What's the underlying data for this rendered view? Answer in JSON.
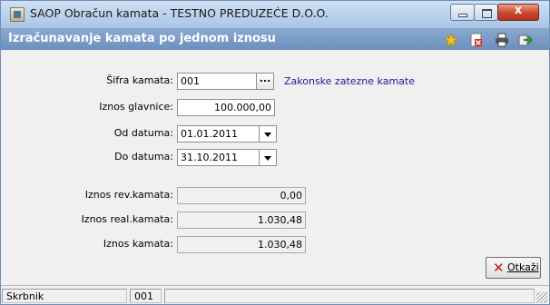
{
  "window": {
    "title": "SAOP Obračun kamata - TESTNO PREDUZEĆE D.O.O.",
    "close_glyph": "x"
  },
  "header": {
    "title": "Izračunavanje kamata po jednom iznosu",
    "toolbar_icons": [
      "star-icon",
      "close-document-icon",
      "printer-icon",
      "export-icon"
    ]
  },
  "form": {
    "sifra_label": "Šifra kamata:",
    "sifra_value": "001",
    "sifra_button": "...",
    "sifra_description": "Zakonske zatezne kamate",
    "glavnica_label": "Iznos glavnice:",
    "glavnica_value": "100.000,00",
    "od_label": "Od datuma:",
    "od_value": "01.01.2011",
    "do_label": "Do datuma:",
    "do_value": "31.10.2011",
    "rev_label": "Iznos rev.kamata:",
    "rev_value": "0,00",
    "real_label": "Iznos real.kamata:",
    "real_value": "1.030,48",
    "total_label": "Iznos kamata:",
    "total_value": "1.030,48"
  },
  "actions": {
    "cancel_label": "Otkaži"
  },
  "statusbar": {
    "user": "Skrbnik",
    "code": "001"
  },
  "colors": {
    "header_bg": "#7b9bc8",
    "link_text": "#1a1a9c",
    "close_button": "#c9452e"
  }
}
